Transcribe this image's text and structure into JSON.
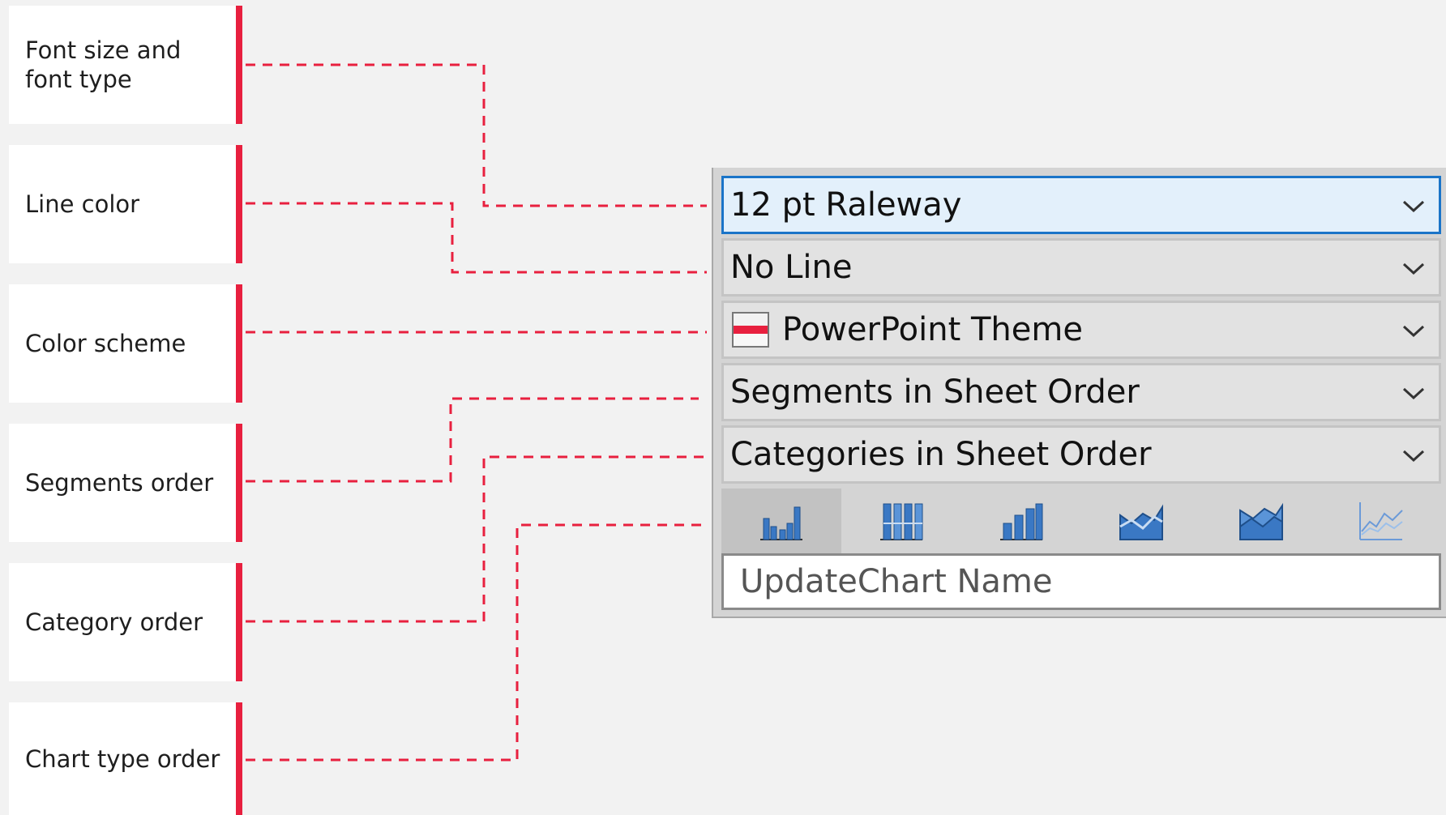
{
  "labels": [
    {
      "id": "font",
      "text": "Font size and font type"
    },
    {
      "id": "line",
      "text": "Line color"
    },
    {
      "id": "color",
      "text": "Color scheme"
    },
    {
      "id": "segments",
      "text": "Segments order"
    },
    {
      "id": "category",
      "text": "Category order"
    },
    {
      "id": "charttype",
      "text": "Chart type order"
    }
  ],
  "panel": {
    "font_dropdown": "12 pt Raleway",
    "line_dropdown": "No Line",
    "color_dropdown": "PowerPoint Theme",
    "segments_dropdown": "Segments in Sheet Order",
    "categories_dropdown": "Categories in Sheet Order",
    "chart_types": [
      {
        "icon": "clustered-column-chart-icon",
        "selected": true
      },
      {
        "icon": "stacked-column-chart-icon",
        "selected": false
      },
      {
        "icon": "column-chart-icon",
        "selected": false
      },
      {
        "icon": "line-area-chart-icon",
        "selected": false
      },
      {
        "icon": "area-chart-icon",
        "selected": false
      },
      {
        "icon": "line-chart-icon",
        "selected": false
      }
    ],
    "name_value": "UpdateChart Name"
  },
  "colors": {
    "accent": "#e8203f",
    "focus_border": "#1a74c8",
    "focus_fill": "#e3f0fb",
    "icon_blue": "#3a78c4"
  }
}
